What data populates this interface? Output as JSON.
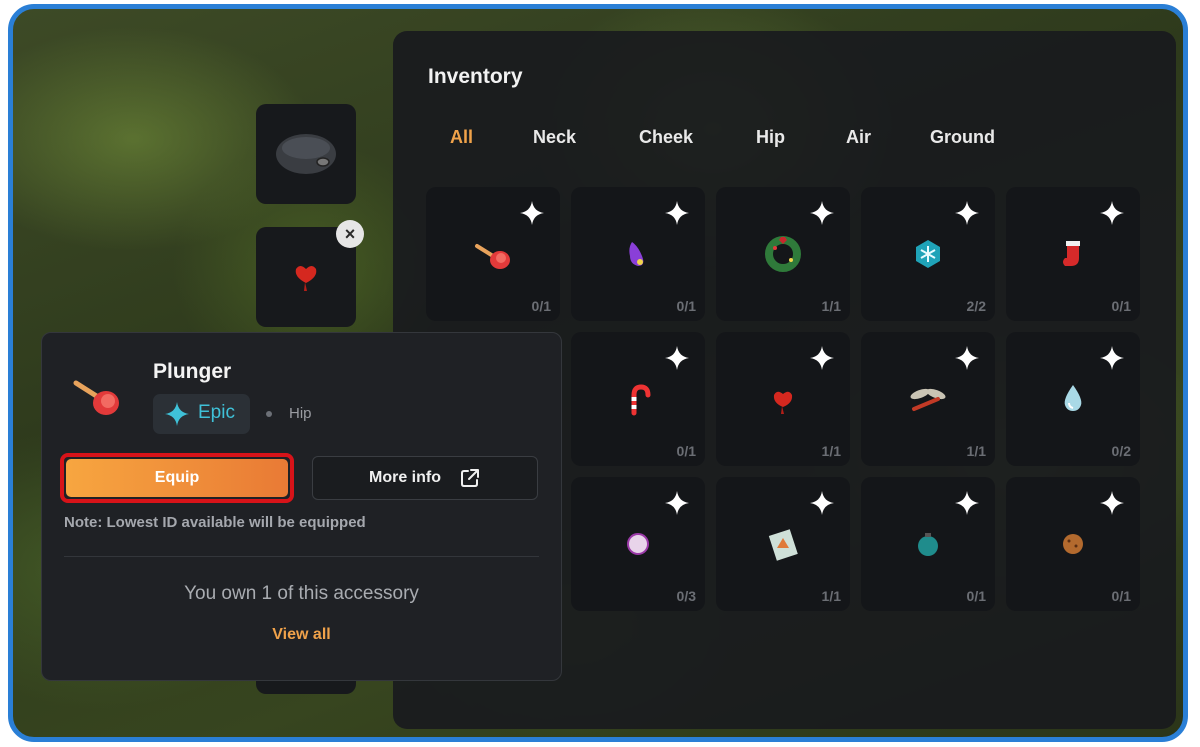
{
  "inventory": {
    "title": "Inventory",
    "tabs": [
      {
        "label": "All",
        "active": true
      },
      {
        "label": "Neck",
        "active": false
      },
      {
        "label": "Cheek",
        "active": false
      },
      {
        "label": "Hip",
        "active": false
      },
      {
        "label": "Air",
        "active": false
      },
      {
        "label": "Ground",
        "active": false
      }
    ],
    "items": [
      {
        "name": "plunger",
        "count": "0/1"
      },
      {
        "name": "purple-slug",
        "count": "0/1"
      },
      {
        "name": "wreath",
        "count": "1/1"
      },
      {
        "name": "snowflake-gem",
        "count": "2/2"
      },
      {
        "name": "stocking",
        "count": "0/1"
      },
      {
        "name": "hidden-item",
        "count": ""
      },
      {
        "name": "candy-cane",
        "count": "0/1"
      },
      {
        "name": "red-heart-blob",
        "count": "1/1"
      },
      {
        "name": "dragonfly",
        "count": "1/1"
      },
      {
        "name": "water-drop",
        "count": "0/2"
      },
      {
        "name": "hidden-item",
        "count": ""
      },
      {
        "name": "pearl",
        "count": "0/3"
      },
      {
        "name": "stamp-card",
        "count": "1/1"
      },
      {
        "name": "ornament",
        "count": "0/1"
      },
      {
        "name": "cookie",
        "count": "0/1"
      }
    ]
  },
  "detail": {
    "name": "Plunger",
    "rarity": "Epic",
    "slot": "Hip",
    "equip_label": "Equip",
    "more_info_label": "More info",
    "note": "Note: Lowest ID available will be equipped",
    "ownership": "You own 1 of this accessory",
    "view_all_label": "View all"
  },
  "colors": {
    "accent": "#f0a24a",
    "epic": "#3fc1d8",
    "highlight": "#d71319"
  }
}
